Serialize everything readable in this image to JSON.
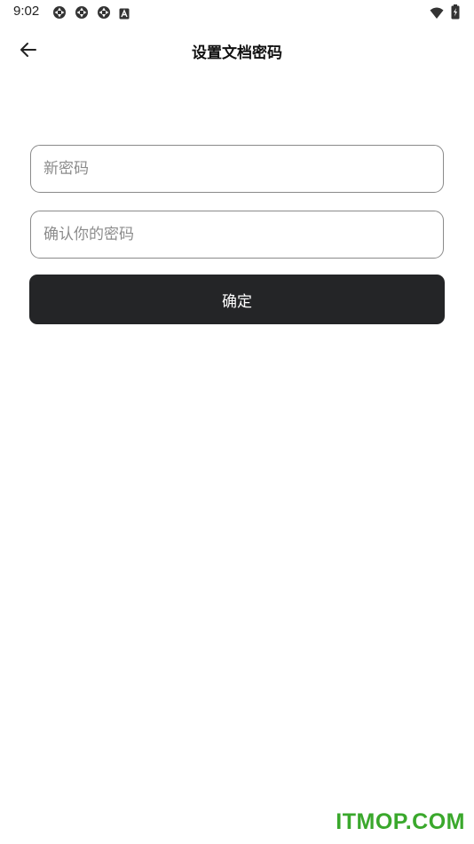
{
  "status_bar": {
    "time": "9:02",
    "icons": [
      "vpn-icon",
      "vpn-icon",
      "vpn-icon",
      "a-notification-icon",
      "wifi-icon",
      "battery-icon"
    ]
  },
  "app_bar": {
    "title": "设置文档密码",
    "back_icon": "arrow-left-icon"
  },
  "form": {
    "new_password": {
      "value": "",
      "placeholder": "新密码"
    },
    "confirm_password": {
      "value": "",
      "placeholder": "确认你的密码"
    },
    "confirm_label": "确定"
  },
  "watermark": "ITMOP.COM",
  "colors": {
    "button_bg": "#242527",
    "field_border": "#8a8a8a",
    "watermark": "#3aa82c"
  }
}
